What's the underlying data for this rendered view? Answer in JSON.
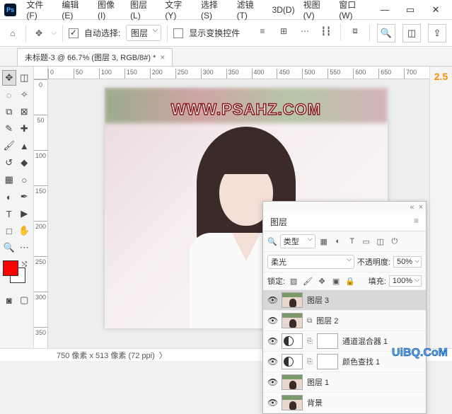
{
  "menu": {
    "file": "文件(F)",
    "edit": "编辑(E)",
    "image": "图像(I)",
    "layer": "图层(L)",
    "type": "文字(Y)",
    "select": "选择(S)",
    "filter": "滤镜(T)",
    "threeD": "3D(D)",
    "view": "视图(V)",
    "window": "窗口(W)"
  },
  "options": {
    "auto_select_label": "自动选择:",
    "auto_select_target": "图层",
    "show_transform_label": "显示变换控件"
  },
  "tab": {
    "title": "未标题-3 @ 66.7% (图层 3, RGB/8#) *"
  },
  "ruler_h": [
    "0",
    "50",
    "100",
    "150",
    "200",
    "250",
    "300",
    "350",
    "400",
    "450",
    "500",
    "550",
    "600",
    "650",
    "700"
  ],
  "ruler_v": [
    "0",
    "50",
    "100",
    "150",
    "200",
    "250",
    "300",
    "350"
  ],
  "canvas": {
    "watermark": "WWW.PSAHZ.COM"
  },
  "version": "2.5",
  "layers_panel": {
    "title": "图层",
    "kind_label": "类型",
    "blend_mode": "柔光",
    "opacity_label": "不透明度:",
    "opacity_value": "50%",
    "lock_label": "锁定:",
    "fill_label": "填充:",
    "fill_value": "100%",
    "items": [
      {
        "name": "图层 3",
        "selected": true,
        "type": "photo"
      },
      {
        "name": "图层 2",
        "selected": false,
        "type": "photo_linked"
      },
      {
        "name": "通道混合器 1",
        "selected": false,
        "type": "adjustment"
      },
      {
        "name": "颜色查找 1",
        "selected": false,
        "type": "adjustment"
      },
      {
        "name": "图层 1",
        "selected": false,
        "type": "photo"
      },
      {
        "name": "背景",
        "selected": false,
        "type": "photo"
      }
    ]
  },
  "status": {
    "dims": "750 像素 x 513 像素 (72 ppi)"
  },
  "footer_watermark": "UiBQ.CoM"
}
